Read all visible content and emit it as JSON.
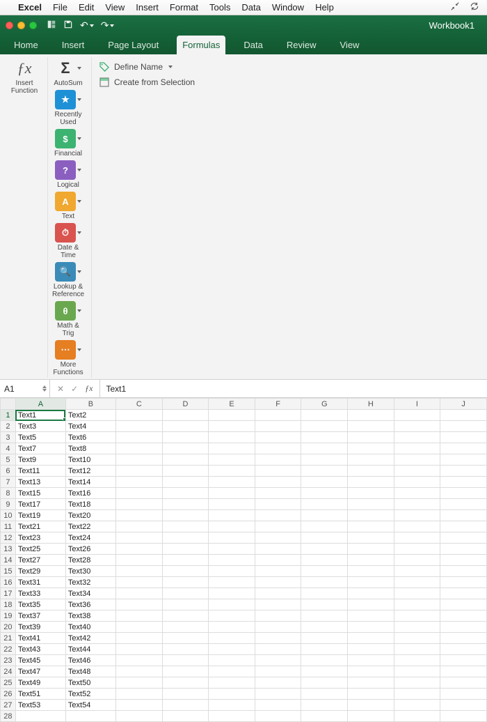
{
  "mac_menu": {
    "app": "Excel",
    "items": [
      "File",
      "Edit",
      "View",
      "Insert",
      "Format",
      "Tools",
      "Data",
      "Window",
      "Help"
    ]
  },
  "window": {
    "title": "Workbook1"
  },
  "ribbon_tabs": [
    "Home",
    "Insert",
    "Page Layout",
    "Formulas",
    "Data",
    "Review",
    "View"
  ],
  "active_tab": "Formulas",
  "ribbon": {
    "insert_function": "Insert\nFunction",
    "autosum": "AutoSum",
    "recent": "Recently\nUsed",
    "financial": "Financial",
    "logical": "Logical",
    "text": "Text",
    "date_time": "Date &\nTime",
    "lookup": "Lookup &\nReference",
    "math": "Math &\nTrig",
    "more": "More\nFunctions",
    "define_name": "Define Name",
    "create_from_selection": "Create from Selection"
  },
  "namebox": "A1",
  "formula_value": "Text1",
  "columns": [
    "A",
    "B",
    "C",
    "D",
    "E",
    "F",
    "G",
    "H",
    "I",
    "J"
  ],
  "col_widths": [
    "c-A",
    "c-B",
    "c-rest",
    "c-rest",
    "c-rest",
    "c-rest",
    "c-rest",
    "c-rest",
    "c-rest",
    "c-rest"
  ],
  "rows": 28,
  "active_cell": {
    "row": 1,
    "col": "A"
  },
  "data": {
    "1": {
      "A": "Text1",
      "B": "Text2"
    },
    "2": {
      "A": "Text3",
      "B": "Text4"
    },
    "3": {
      "A": "Text5",
      "B": "Text6"
    },
    "4": {
      "A": "Text7",
      "B": "Text8"
    },
    "5": {
      "A": "Text9",
      "B": "Text10"
    },
    "6": {
      "A": "Text11",
      "B": "Text12"
    },
    "7": {
      "A": "Text13",
      "B": "Text14"
    },
    "8": {
      "A": "Text15",
      "B": "Text16"
    },
    "9": {
      "A": "Text17",
      "B": "Text18"
    },
    "10": {
      "A": "Text19",
      "B": "Text20"
    },
    "11": {
      "A": "Text21",
      "B": "Text22"
    },
    "12": {
      "A": "Text23",
      "B": "Text24"
    },
    "13": {
      "A": "Text25",
      "B": "Text26"
    },
    "14": {
      "A": "Text27",
      "B": "Text28"
    },
    "15": {
      "A": "Text29",
      "B": "Text30"
    },
    "16": {
      "A": "Text31",
      "B": "Text32"
    },
    "17": {
      "A": "Text33",
      "B": "Text34"
    },
    "18": {
      "A": "Text35",
      "B": "Text36"
    },
    "19": {
      "A": "Text37",
      "B": "Text38"
    },
    "20": {
      "A": "Text39",
      "B": "Text40"
    },
    "21": {
      "A": "Text41",
      "B": "Text42"
    },
    "22": {
      "A": "Text43",
      "B": "Text44"
    },
    "23": {
      "A": "Text45",
      "B": "Text46"
    },
    "24": {
      "A": "Text47",
      "B": "Text48"
    },
    "25": {
      "A": "Text49",
      "B": "Text50"
    },
    "26": {
      "A": "Text51",
      "B": "Text52"
    },
    "27": {
      "A": "Text53",
      "B": "Text54"
    }
  },
  "colors": {
    "recent": "#1e90d6",
    "financial": "#3cb371",
    "logical": "#8b5fbf",
    "text": "#f0a830",
    "date_time": "#d9534f",
    "lookup": "#3a8bb8",
    "math": "#6aa84f",
    "more": "#e67e22"
  }
}
